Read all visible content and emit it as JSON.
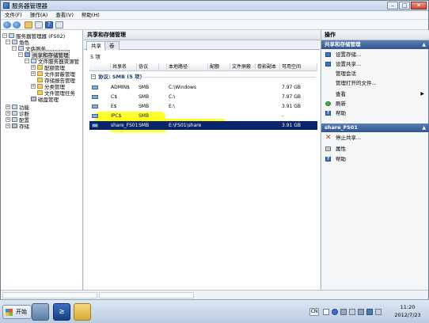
{
  "window": {
    "title": "服务器管理器",
    "controls": {
      "minimize": "–",
      "maximize": "□",
      "close": "✕"
    }
  },
  "menu": [
    "文件(F)",
    "操作(A)",
    "查看(V)",
    "帮助(H)"
  ],
  "toolbar": {
    "icons": [
      "back-icon",
      "forward-icon",
      "up-icon",
      "tree-icon",
      "help-icon",
      "panel-icon"
    ],
    "help_glyph": "?"
  },
  "tree": {
    "root": "服务器管理器 (FS02)",
    "roles": "角色",
    "file_services": "文件服务",
    "share_storage": "共享和存储管理",
    "fsrm": "文件服务器资源管",
    "quota": "配额管理",
    "file_screen": "文件屏蔽管理",
    "storage_reports": "存储报告管理",
    "classification": "分类管理",
    "file_tasks": "文件管理任务",
    "disk_mgmt": "磁盘管理",
    "features": "功能",
    "diagnostics": "诊断",
    "configuration": "配置",
    "storage": "存储"
  },
  "center": {
    "title": "共享和存储管理",
    "tabs": [
      "共享",
      "卷"
    ],
    "count": "5 项",
    "columns": [
      "共享名",
      "协议",
      "本地路径",
      "配额",
      "文件屏蔽",
      "卷影副本",
      "可用空间"
    ],
    "group": "协议: SMB (5 项)",
    "rows": [
      {
        "name": "ADMIN$",
        "protocol": "SMB",
        "path": "C:\\Windows",
        "free": "7.97 GB"
      },
      {
        "name": "C$",
        "protocol": "SMB",
        "path": "C:\\",
        "free": "7.97 GB"
      },
      {
        "name": "E$",
        "protocol": "SMB",
        "path": "E:\\",
        "free": "3.91 GB"
      },
      {
        "name": "IPC$",
        "protocol": "SMB",
        "path": "",
        "free": "-"
      },
      {
        "name": "share_FS01",
        "protocol": "SMB",
        "path": "E:\\FS01\\share",
        "free": "3.91 GB"
      }
    ]
  },
  "actions": {
    "header": "操作",
    "section1": "共享和存储管理",
    "section1_items": [
      "设置存储...",
      "设置共享...",
      "管理会话",
      "管理打开的文件...",
      "查看",
      "刷新",
      "帮助"
    ],
    "section2": "share_FS01",
    "section2_items": [
      "停止共享...",
      "属性",
      "帮助"
    ],
    "caret": "▲",
    "submenu_arrow": "▶",
    "stop_glyph": "✕",
    "help_glyph": "?"
  },
  "taskbar": {
    "start": "开始",
    "powershell_glyph": "≥",
    "lang": "CN",
    "time": "11:20",
    "date": "2012/7/23"
  },
  "colors": {
    "selection": "#0a246a",
    "highlight": "#ffff00",
    "section_header": "#2f5590"
  }
}
